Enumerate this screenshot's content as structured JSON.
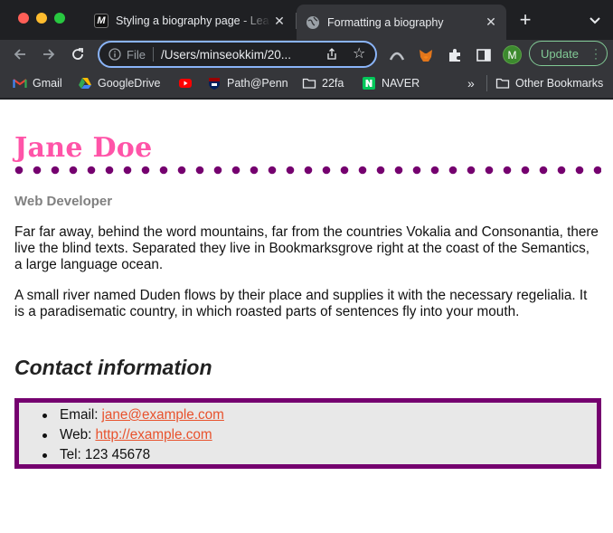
{
  "tabs": [
    {
      "favicon": "M",
      "title": "Styling a biography page - Lea",
      "active": false
    },
    {
      "favicon": "globe-icon",
      "title": "Formatting a biography",
      "active": true
    }
  ],
  "toolbar": {
    "omnibox_scheme": "File",
    "omnibox_url": "/Users/minseokkim/20...",
    "avatar_initial": "M",
    "update_label": "Update"
  },
  "bookmarks": [
    {
      "icon": "gmail-icon",
      "label": "Gmail"
    },
    {
      "icon": "google-drive-icon",
      "label": "GoogleDrive"
    },
    {
      "icon": "youtube-icon",
      "label": ""
    },
    {
      "icon": "penn-shield-icon",
      "label": "Path@Penn"
    },
    {
      "icon": "folder-icon",
      "label": "22fa"
    },
    {
      "icon": "naver-icon",
      "label": "NAVER"
    }
  ],
  "bookmarks_overflow": "»",
  "other_bookmarks": "Other Bookmarks",
  "page": {
    "title": "Jane Doe",
    "subtitle": "Web Developer",
    "paragraph_1": "Far far away, behind the word mountains, far from the countries Vokalia and Consonantia, there live the blind texts. Separated they live in Bookmarksgrove right at the coast of the Semantics, a large language ocean.",
    "paragraph_2": "A small river named Duden flows by their place and supplies it with the necessary regelialia. It is a paradisematic country, in which roasted parts of sentences fly into your mouth.",
    "contact_heading": "Contact information",
    "contacts": [
      {
        "label": "Email:",
        "value": "jane@example.com",
        "is_link": true
      },
      {
        "label": "Web:",
        "value": "http://example.com",
        "is_link": true
      },
      {
        "label": "Tel:",
        "value": "123 45678",
        "is_link": false
      }
    ]
  },
  "colors": {
    "title_pink": "#ff54a8",
    "accent_purple": "#75006f",
    "link_orange": "#e8522d",
    "subtitle_gray": "#808080",
    "contact_bg": "#e8e8e8"
  }
}
